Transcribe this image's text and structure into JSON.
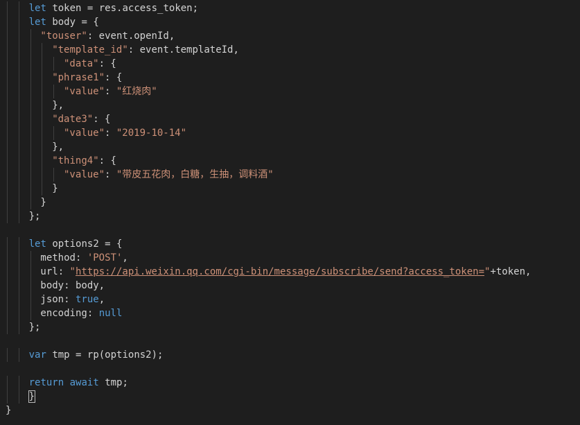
{
  "theme": {
    "background": "#1e1e1e",
    "keyword": "#569cd6",
    "string": "#ce9178",
    "identifier": "#d4d4d4"
  },
  "code_lines": [
    {
      "indent": 4,
      "tokens": [
        [
          "kw",
          "let"
        ],
        [
          "id",
          " token = res.access_token;"
        ]
      ]
    },
    {
      "indent": 4,
      "tokens": [
        [
          "kw",
          "let"
        ],
        [
          "id",
          " body = {"
        ]
      ]
    },
    {
      "indent": 6,
      "tokens": [
        [
          "key",
          "\"touser\""
        ],
        [
          "id",
          ": event.openId,"
        ]
      ]
    },
    {
      "indent": 8,
      "tokens": [
        [
          "key",
          "\"template_id\""
        ],
        [
          "id",
          ": event.templateId,"
        ]
      ]
    },
    {
      "indent": 10,
      "tokens": [
        [
          "key",
          "\"data\""
        ],
        [
          "id",
          ": {"
        ]
      ]
    },
    {
      "indent": 8,
      "tokens": [
        [
          "key",
          "\"phrase1\""
        ],
        [
          "id",
          ": {"
        ]
      ]
    },
    {
      "indent": 10,
      "tokens": [
        [
          "key",
          "\"value\""
        ],
        [
          "id",
          ": "
        ],
        [
          "str",
          "\"红烧肉\""
        ]
      ]
    },
    {
      "indent": 8,
      "tokens": [
        [
          "id",
          "},"
        ]
      ]
    },
    {
      "indent": 8,
      "tokens": [
        [
          "key",
          "\"date3\""
        ],
        [
          "id",
          ": {"
        ]
      ]
    },
    {
      "indent": 10,
      "tokens": [
        [
          "key",
          "\"value\""
        ],
        [
          "id",
          ": "
        ],
        [
          "str",
          "\"2019-10-14\""
        ]
      ]
    },
    {
      "indent": 8,
      "tokens": [
        [
          "id",
          "},"
        ]
      ]
    },
    {
      "indent": 8,
      "tokens": [
        [
          "key",
          "\"thing4\""
        ],
        [
          "id",
          ": {"
        ]
      ]
    },
    {
      "indent": 10,
      "tokens": [
        [
          "key",
          "\"value\""
        ],
        [
          "id",
          ": "
        ],
        [
          "str",
          "\"带皮五花肉，白糖，生抽，调料酒\""
        ]
      ]
    },
    {
      "indent": 8,
      "tokens": [
        [
          "id",
          "}"
        ]
      ]
    },
    {
      "indent": 6,
      "tokens": [
        [
          "id",
          "}"
        ]
      ]
    },
    {
      "indent": 4,
      "tokens": [
        [
          "id",
          "};"
        ]
      ]
    },
    {
      "indent": 0,
      "tokens": []
    },
    {
      "indent": 4,
      "tokens": [
        [
          "kw",
          "let"
        ],
        [
          "id",
          " options2 = {"
        ]
      ]
    },
    {
      "indent": 6,
      "tokens": [
        [
          "prop",
          "method"
        ],
        [
          "id",
          ": "
        ],
        [
          "str",
          "'POST'"
        ],
        [
          "id",
          ","
        ]
      ]
    },
    {
      "indent": 6,
      "tokens": [
        [
          "prop",
          "url"
        ],
        [
          "id",
          ": "
        ],
        [
          "str",
          "\""
        ],
        [
          "url",
          "https://api.weixin.qq.com/cgi-bin/message/subscribe/send?access_token="
        ],
        [
          "str",
          "\""
        ],
        [
          "id",
          "+token,"
        ]
      ]
    },
    {
      "indent": 6,
      "tokens": [
        [
          "prop",
          "body"
        ],
        [
          "id",
          ": body,"
        ]
      ]
    },
    {
      "indent": 6,
      "tokens": [
        [
          "prop",
          "json"
        ],
        [
          "id",
          ": "
        ],
        [
          "kw",
          "true"
        ],
        [
          "id",
          ","
        ]
      ]
    },
    {
      "indent": 6,
      "tokens": [
        [
          "prop",
          "encoding"
        ],
        [
          "id",
          ": "
        ],
        [
          "kw",
          "null"
        ]
      ]
    },
    {
      "indent": 4,
      "tokens": [
        [
          "id",
          "};"
        ]
      ]
    },
    {
      "indent": 0,
      "tokens": []
    },
    {
      "indent": 4,
      "tokens": [
        [
          "kw",
          "var"
        ],
        [
          "id",
          " tmp = rp(options2);"
        ]
      ]
    },
    {
      "indent": 0,
      "tokens": []
    },
    {
      "indent": 4,
      "tokens": [
        [
          "kw",
          "return"
        ],
        [
          "id",
          " "
        ],
        [
          "kw",
          "await"
        ],
        [
          "id",
          " tmp;"
        ]
      ]
    },
    {
      "indent": 4,
      "tokens": [
        [
          "cursor",
          "}"
        ]
      ]
    },
    {
      "indent": 0,
      "tokens": [
        [
          "id",
          "}"
        ]
      ]
    }
  ]
}
